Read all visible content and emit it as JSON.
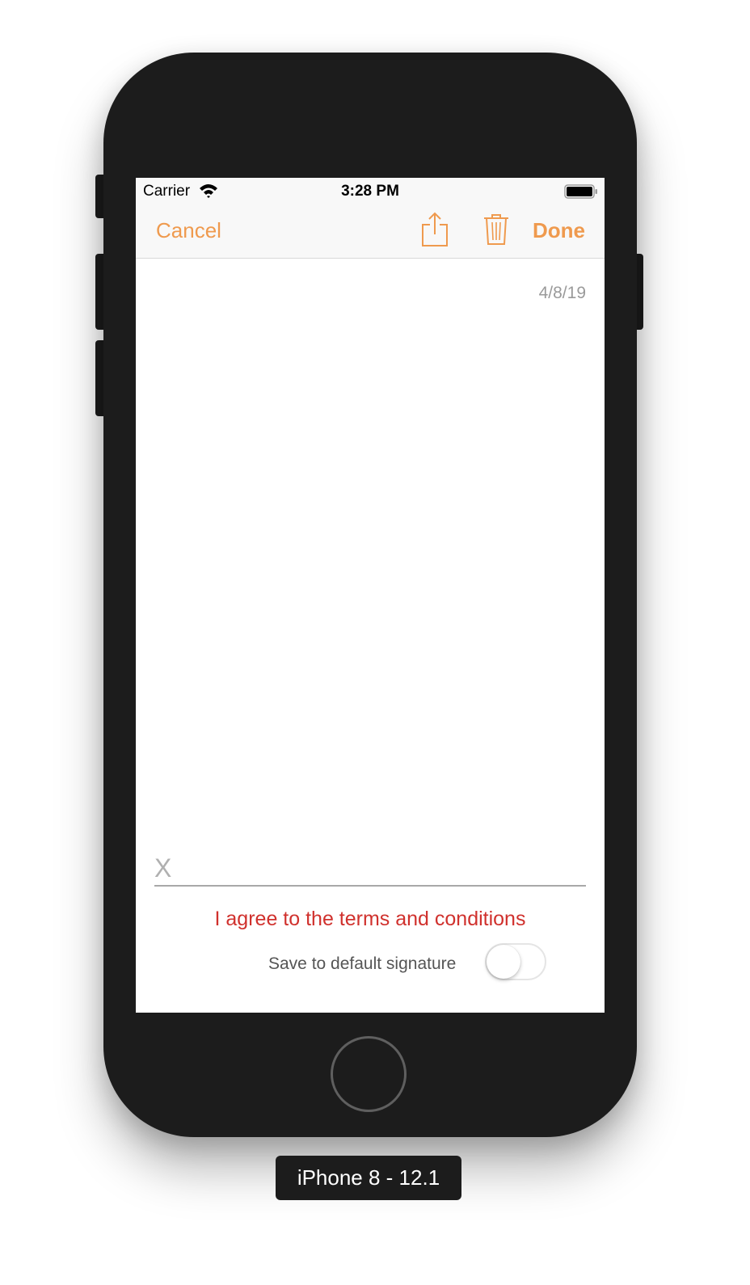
{
  "status_bar": {
    "carrier": "Carrier",
    "time": "3:28 PM"
  },
  "nav_bar": {
    "cancel_label": "Cancel",
    "done_label": "Done",
    "accent_color": "#ef9a4e",
    "icons": [
      "share-icon",
      "trash-icon"
    ]
  },
  "signature": {
    "date": "4/8/19",
    "x_mark": "X",
    "terms_text": "I agree to the terms and conditions",
    "terms_color": "#d0312d",
    "save_default_label": "Save to default signature",
    "save_default_on": false
  },
  "device": {
    "label": "iPhone 8 - 12.1"
  }
}
